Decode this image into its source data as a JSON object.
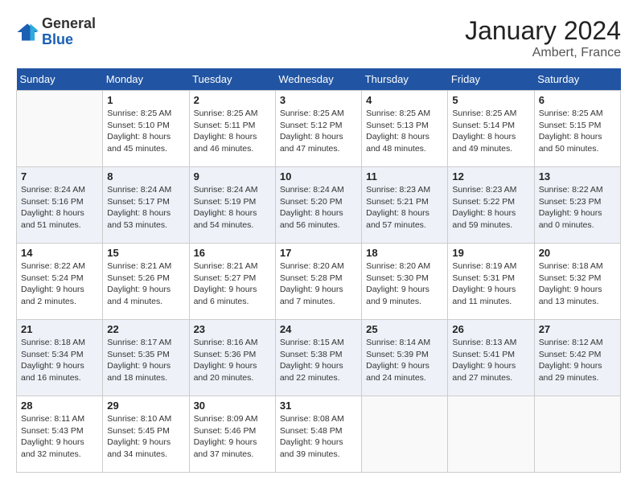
{
  "header": {
    "logo": {
      "general": "General",
      "blue": "Blue"
    },
    "title": "January 2024",
    "location": "Ambert, France"
  },
  "days_of_week": [
    "Sunday",
    "Monday",
    "Tuesday",
    "Wednesday",
    "Thursday",
    "Friday",
    "Saturday"
  ],
  "weeks": [
    [
      {
        "day": "",
        "sunrise": "",
        "sunset": "",
        "daylight": ""
      },
      {
        "day": "1",
        "sunrise": "Sunrise: 8:25 AM",
        "sunset": "Sunset: 5:10 PM",
        "daylight": "Daylight: 8 hours and 45 minutes."
      },
      {
        "day": "2",
        "sunrise": "Sunrise: 8:25 AM",
        "sunset": "Sunset: 5:11 PM",
        "daylight": "Daylight: 8 hours and 46 minutes."
      },
      {
        "day": "3",
        "sunrise": "Sunrise: 8:25 AM",
        "sunset": "Sunset: 5:12 PM",
        "daylight": "Daylight: 8 hours and 47 minutes."
      },
      {
        "day": "4",
        "sunrise": "Sunrise: 8:25 AM",
        "sunset": "Sunset: 5:13 PM",
        "daylight": "Daylight: 8 hours and 48 minutes."
      },
      {
        "day": "5",
        "sunrise": "Sunrise: 8:25 AM",
        "sunset": "Sunset: 5:14 PM",
        "daylight": "Daylight: 8 hours and 49 minutes."
      },
      {
        "day": "6",
        "sunrise": "Sunrise: 8:25 AM",
        "sunset": "Sunset: 5:15 PM",
        "daylight": "Daylight: 8 hours and 50 minutes."
      }
    ],
    [
      {
        "day": "7",
        "sunrise": "Sunrise: 8:24 AM",
        "sunset": "Sunset: 5:16 PM",
        "daylight": "Daylight: 8 hours and 51 minutes."
      },
      {
        "day": "8",
        "sunrise": "Sunrise: 8:24 AM",
        "sunset": "Sunset: 5:17 PM",
        "daylight": "Daylight: 8 hours and 53 minutes."
      },
      {
        "day": "9",
        "sunrise": "Sunrise: 8:24 AM",
        "sunset": "Sunset: 5:19 PM",
        "daylight": "Daylight: 8 hours and 54 minutes."
      },
      {
        "day": "10",
        "sunrise": "Sunrise: 8:24 AM",
        "sunset": "Sunset: 5:20 PM",
        "daylight": "Daylight: 8 hours and 56 minutes."
      },
      {
        "day": "11",
        "sunrise": "Sunrise: 8:23 AM",
        "sunset": "Sunset: 5:21 PM",
        "daylight": "Daylight: 8 hours and 57 minutes."
      },
      {
        "day": "12",
        "sunrise": "Sunrise: 8:23 AM",
        "sunset": "Sunset: 5:22 PM",
        "daylight": "Daylight: 8 hours and 59 minutes."
      },
      {
        "day": "13",
        "sunrise": "Sunrise: 8:22 AM",
        "sunset": "Sunset: 5:23 PM",
        "daylight": "Daylight: 9 hours and 0 minutes."
      }
    ],
    [
      {
        "day": "14",
        "sunrise": "Sunrise: 8:22 AM",
        "sunset": "Sunset: 5:24 PM",
        "daylight": "Daylight: 9 hours and 2 minutes."
      },
      {
        "day": "15",
        "sunrise": "Sunrise: 8:21 AM",
        "sunset": "Sunset: 5:26 PM",
        "daylight": "Daylight: 9 hours and 4 minutes."
      },
      {
        "day": "16",
        "sunrise": "Sunrise: 8:21 AM",
        "sunset": "Sunset: 5:27 PM",
        "daylight": "Daylight: 9 hours and 6 minutes."
      },
      {
        "day": "17",
        "sunrise": "Sunrise: 8:20 AM",
        "sunset": "Sunset: 5:28 PM",
        "daylight": "Daylight: 9 hours and 7 minutes."
      },
      {
        "day": "18",
        "sunrise": "Sunrise: 8:20 AM",
        "sunset": "Sunset: 5:30 PM",
        "daylight": "Daylight: 9 hours and 9 minutes."
      },
      {
        "day": "19",
        "sunrise": "Sunrise: 8:19 AM",
        "sunset": "Sunset: 5:31 PM",
        "daylight": "Daylight: 9 hours and 11 minutes."
      },
      {
        "day": "20",
        "sunrise": "Sunrise: 8:18 AM",
        "sunset": "Sunset: 5:32 PM",
        "daylight": "Daylight: 9 hours and 13 minutes."
      }
    ],
    [
      {
        "day": "21",
        "sunrise": "Sunrise: 8:18 AM",
        "sunset": "Sunset: 5:34 PM",
        "daylight": "Daylight: 9 hours and 16 minutes."
      },
      {
        "day": "22",
        "sunrise": "Sunrise: 8:17 AM",
        "sunset": "Sunset: 5:35 PM",
        "daylight": "Daylight: 9 hours and 18 minutes."
      },
      {
        "day": "23",
        "sunrise": "Sunrise: 8:16 AM",
        "sunset": "Sunset: 5:36 PM",
        "daylight": "Daylight: 9 hours and 20 minutes."
      },
      {
        "day": "24",
        "sunrise": "Sunrise: 8:15 AM",
        "sunset": "Sunset: 5:38 PM",
        "daylight": "Daylight: 9 hours and 22 minutes."
      },
      {
        "day": "25",
        "sunrise": "Sunrise: 8:14 AM",
        "sunset": "Sunset: 5:39 PM",
        "daylight": "Daylight: 9 hours and 24 minutes."
      },
      {
        "day": "26",
        "sunrise": "Sunrise: 8:13 AM",
        "sunset": "Sunset: 5:41 PM",
        "daylight": "Daylight: 9 hours and 27 minutes."
      },
      {
        "day": "27",
        "sunrise": "Sunrise: 8:12 AM",
        "sunset": "Sunset: 5:42 PM",
        "daylight": "Daylight: 9 hours and 29 minutes."
      }
    ],
    [
      {
        "day": "28",
        "sunrise": "Sunrise: 8:11 AM",
        "sunset": "Sunset: 5:43 PM",
        "daylight": "Daylight: 9 hours and 32 minutes."
      },
      {
        "day": "29",
        "sunrise": "Sunrise: 8:10 AM",
        "sunset": "Sunset: 5:45 PM",
        "daylight": "Daylight: 9 hours and 34 minutes."
      },
      {
        "day": "30",
        "sunrise": "Sunrise: 8:09 AM",
        "sunset": "Sunset: 5:46 PM",
        "daylight": "Daylight: 9 hours and 37 minutes."
      },
      {
        "day": "31",
        "sunrise": "Sunrise: 8:08 AM",
        "sunset": "Sunset: 5:48 PM",
        "daylight": "Daylight: 9 hours and 39 minutes."
      },
      {
        "day": "",
        "sunrise": "",
        "sunset": "",
        "daylight": ""
      },
      {
        "day": "",
        "sunrise": "",
        "sunset": "",
        "daylight": ""
      },
      {
        "day": "",
        "sunrise": "",
        "sunset": "",
        "daylight": ""
      }
    ]
  ]
}
